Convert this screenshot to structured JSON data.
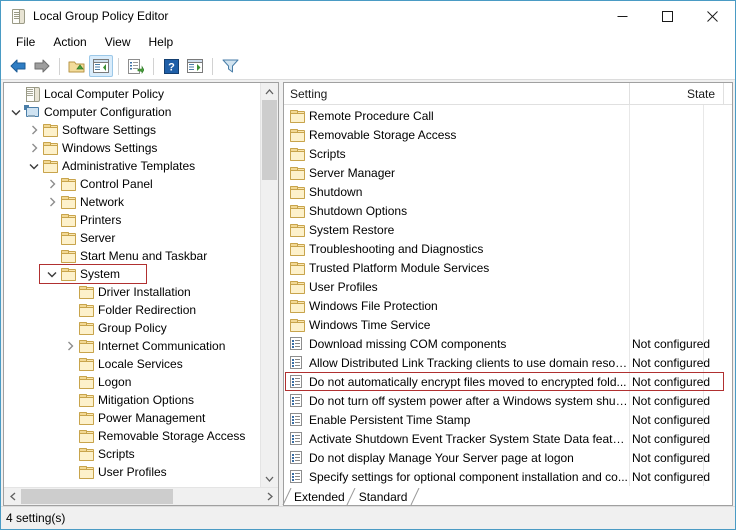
{
  "window": {
    "title": "Local Group Policy Editor",
    "title_icon": "policy-document-icon",
    "minimize_label": "—",
    "maximize_label": "☐",
    "close_label": "✕"
  },
  "menu": {
    "items": [
      {
        "label": "File"
      },
      {
        "label": "Action"
      },
      {
        "label": "View"
      },
      {
        "label": "Help"
      }
    ]
  },
  "toolbar": {
    "buttons": [
      {
        "name": "back-icon",
        "tooltip": "Back"
      },
      {
        "name": "forward-icon",
        "tooltip": "Forward"
      },
      {
        "name": "up-one-level-icon",
        "tooltip": "Up One Level"
      },
      {
        "name": "show-hide-console-tree-icon",
        "tooltip": "Show/Hide Console Tree",
        "pressed": true
      },
      {
        "name": "export-list-icon",
        "tooltip": "Export List"
      },
      {
        "name": "help-icon",
        "tooltip": "Help"
      },
      {
        "name": "show-hide-action-pane-icon",
        "tooltip": "Show/Hide Action Pane"
      },
      {
        "name": "filter-icon",
        "tooltip": "Filter"
      }
    ]
  },
  "tree": {
    "items": [
      {
        "label": "Local Computer Policy",
        "indent": 0,
        "icon": "policy-document-icon",
        "twisty": "none"
      },
      {
        "label": "Computer Configuration",
        "indent": 0,
        "icon": "computer-icon",
        "twisty": "expanded"
      },
      {
        "label": "Software Settings",
        "indent": 1,
        "icon": "folder-icon",
        "twisty": "collapsed"
      },
      {
        "label": "Windows Settings",
        "indent": 1,
        "icon": "folder-icon",
        "twisty": "collapsed"
      },
      {
        "label": "Administrative Templates",
        "indent": 1,
        "icon": "folder-icon",
        "twisty": "expanded"
      },
      {
        "label": "Control Panel",
        "indent": 2,
        "icon": "folder-icon",
        "twisty": "collapsed"
      },
      {
        "label": "Network",
        "indent": 2,
        "icon": "folder-icon",
        "twisty": "collapsed"
      },
      {
        "label": "Printers",
        "indent": 2,
        "icon": "folder-icon",
        "twisty": "none"
      },
      {
        "label": "Server",
        "indent": 2,
        "icon": "folder-icon",
        "twisty": "none"
      },
      {
        "label": "Start Menu and Taskbar",
        "indent": 2,
        "icon": "folder-icon",
        "twisty": "none"
      },
      {
        "label": "System",
        "indent": 2,
        "icon": "folder-icon",
        "twisty": "expanded",
        "highlighted": true
      },
      {
        "label": "Driver Installation",
        "indent": 3,
        "icon": "folder-icon",
        "twisty": "none"
      },
      {
        "label": "Folder Redirection",
        "indent": 3,
        "icon": "folder-icon",
        "twisty": "none"
      },
      {
        "label": "Group Policy",
        "indent": 3,
        "icon": "folder-icon",
        "twisty": "none"
      },
      {
        "label": "Internet Communication",
        "indent": 3,
        "icon": "folder-icon",
        "twisty": "collapsed"
      },
      {
        "label": "Locale Services",
        "indent": 3,
        "icon": "folder-icon",
        "twisty": "none"
      },
      {
        "label": "Logon",
        "indent": 3,
        "icon": "folder-icon",
        "twisty": "none"
      },
      {
        "label": "Mitigation Options",
        "indent": 3,
        "icon": "folder-icon",
        "twisty": "none"
      },
      {
        "label": "Power Management",
        "indent": 3,
        "icon": "folder-icon",
        "twisty": "none"
      },
      {
        "label": "Removable Storage Access",
        "indent": 3,
        "icon": "folder-icon",
        "twisty": "none"
      },
      {
        "label": "Scripts",
        "indent": 3,
        "icon": "folder-icon",
        "twisty": "none"
      },
      {
        "label": "User Profiles",
        "indent": 3,
        "icon": "folder-icon",
        "twisty": "none"
      }
    ]
  },
  "list": {
    "columns": [
      {
        "label": "Setting"
      },
      {
        "label": "State"
      }
    ],
    "rows": [
      {
        "name": "Remote Procedure Call",
        "state": "",
        "icon": "folder-icon"
      },
      {
        "name": "Removable Storage Access",
        "state": "",
        "icon": "folder-icon"
      },
      {
        "name": "Scripts",
        "state": "",
        "icon": "folder-icon"
      },
      {
        "name": "Server Manager",
        "state": "",
        "icon": "folder-icon"
      },
      {
        "name": "Shutdown",
        "state": "",
        "icon": "folder-icon"
      },
      {
        "name": "Shutdown Options",
        "state": "",
        "icon": "folder-icon"
      },
      {
        "name": "System Restore",
        "state": "",
        "icon": "folder-icon"
      },
      {
        "name": "Troubleshooting and Diagnostics",
        "state": "",
        "icon": "folder-icon"
      },
      {
        "name": "Trusted Platform Module Services",
        "state": "",
        "icon": "folder-icon"
      },
      {
        "name": "User Profiles",
        "state": "",
        "icon": "folder-icon"
      },
      {
        "name": "Windows File Protection",
        "state": "",
        "icon": "folder-icon"
      },
      {
        "name": "Windows Time Service",
        "state": "",
        "icon": "folder-icon"
      },
      {
        "name": "Download missing COM components",
        "state": "Not configured",
        "icon": "policy-setting-icon"
      },
      {
        "name": "Allow Distributed Link Tracking clients to use domain resour...",
        "state": "Not configured",
        "icon": "policy-setting-icon"
      },
      {
        "name": "Do not automatically encrypt files moved to encrypted fold...",
        "state": "Not configured",
        "icon": "policy-setting-icon",
        "highlighted": true
      },
      {
        "name": "Do not turn off system power after a Windows system shutd...",
        "state": "Not configured",
        "icon": "policy-setting-icon"
      },
      {
        "name": "Enable Persistent Time Stamp",
        "state": "Not configured",
        "icon": "policy-setting-icon"
      },
      {
        "name": "Activate Shutdown Event Tracker System State Data feature",
        "state": "Not configured",
        "icon": "policy-setting-icon"
      },
      {
        "name": "Do not display Manage Your Server page at logon",
        "state": "Not configured",
        "icon": "policy-setting-icon"
      },
      {
        "name": "Specify settings for optional component installation and co...",
        "state": "Not configured",
        "icon": "policy-setting-icon"
      }
    ],
    "tabs": [
      {
        "label": "Extended",
        "selected": false
      },
      {
        "label": "Standard",
        "selected": true
      }
    ]
  },
  "statusbar": {
    "text": "4 setting(s)"
  },
  "colors": {
    "window_border": "#4a9bc4",
    "highlight_box": "#b03030",
    "folder_fill": "#fbe7b0",
    "folder_stroke": "#c8a44c",
    "toolbar_pressed": "#d9ecfb",
    "scroll_thumb": "#cdcdcd"
  }
}
